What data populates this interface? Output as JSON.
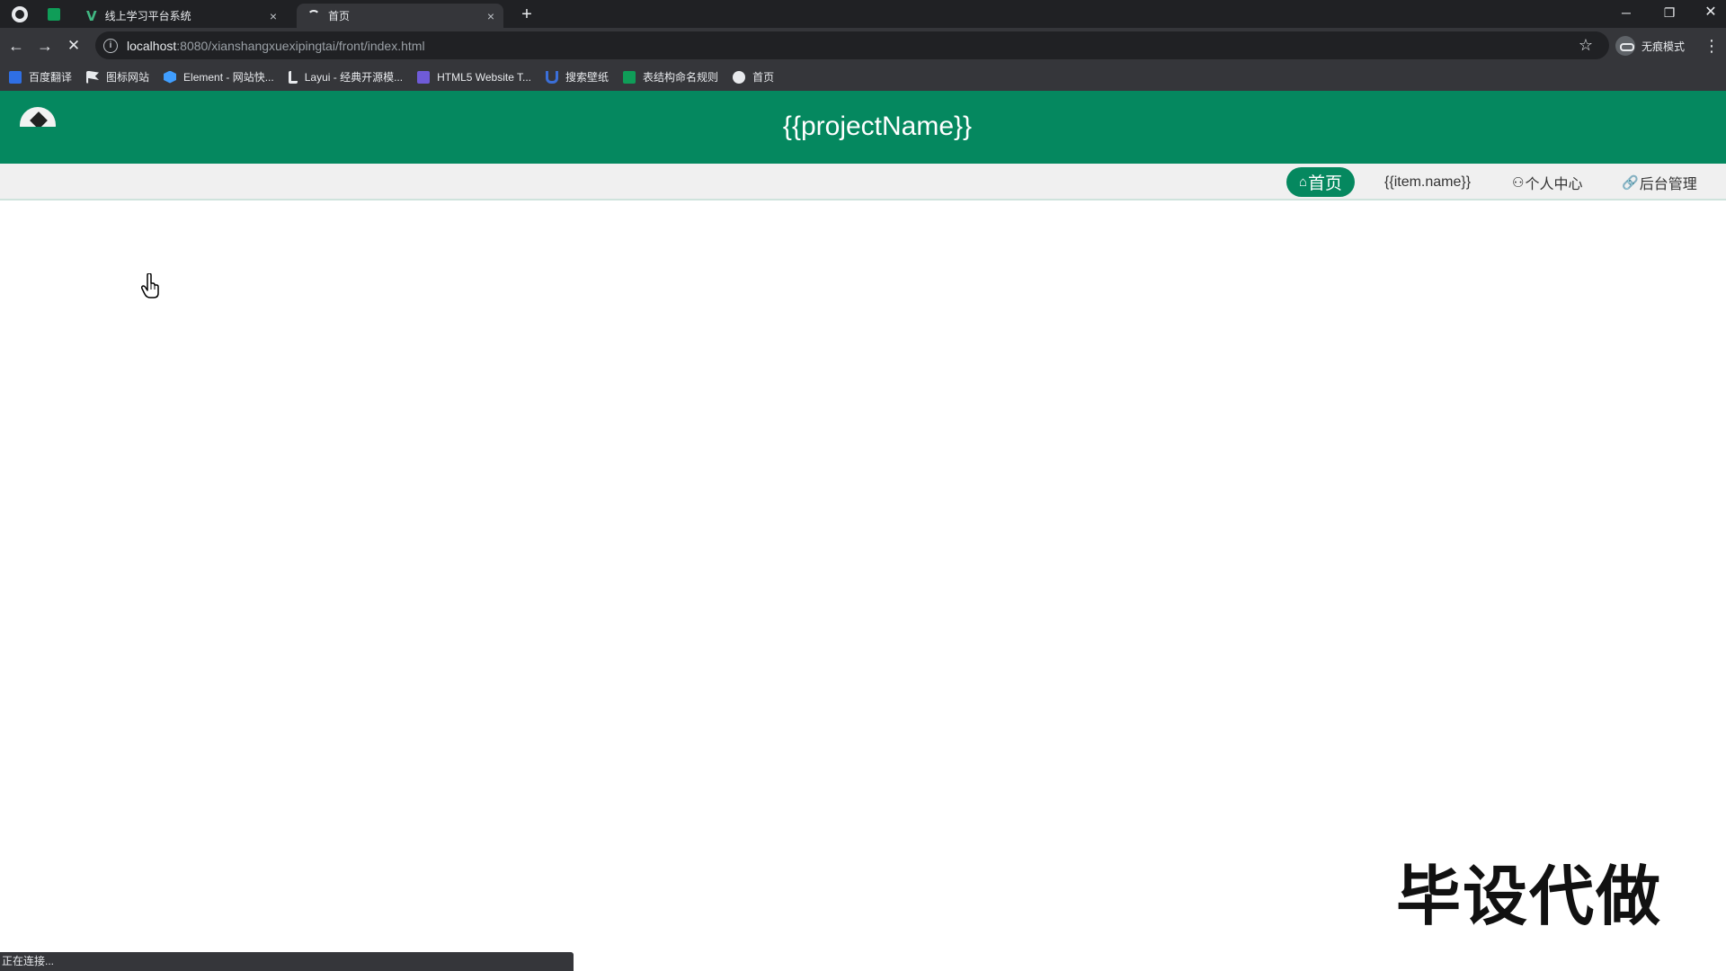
{
  "browser": {
    "tabs": [
      {
        "title": "线上学习平台系统",
        "close": "×"
      },
      {
        "title": "首页",
        "close": "×"
      }
    ],
    "new_tab": "+",
    "window_controls": {
      "minimize": "─",
      "restore": "❐",
      "close": "✕"
    },
    "nav": {
      "back": "←",
      "forward": "→",
      "stop": "✕"
    },
    "url": {
      "host": "localhost",
      "path": ":8080/xianshangxuexipingtai/front/index.html"
    },
    "bookmark_star": "☆",
    "profile_label": "无痕模式",
    "menu": "⋮",
    "bookmarks": [
      {
        "label": "百度翻译",
        "icon": "translate-icon",
        "color": "#2f6fe4"
      },
      {
        "label": "图标网站",
        "icon": "flag-icon",
        "color": "#e8eaed"
      },
      {
        "label": "Element - 网站快...",
        "icon": "element-icon",
        "color": "#409eff"
      },
      {
        "label": "Layui - 经典开源模...",
        "icon": "layui-icon",
        "color": "#e8eaed"
      },
      {
        "label": "HTML5 Website T...",
        "icon": "html5-icon",
        "color": "#6f5bd8"
      },
      {
        "label": "搜索壁纸",
        "icon": "wallpaper-icon",
        "color": "#3b6fd8"
      },
      {
        "label": "表结构命名规则",
        "icon": "sheet-icon",
        "color": "#0f9d58"
      },
      {
        "label": "首页",
        "icon": "globe-icon",
        "color": "#e8eaed"
      }
    ],
    "status": "正在连接..."
  },
  "page": {
    "title": "{{projectName}}",
    "nav": {
      "home": {
        "icon": "⌂",
        "label": "首页"
      },
      "dynamic": {
        "label": "{{item.name}}"
      },
      "user_center": {
        "icon": "⚇",
        "label": "个人中心"
      },
      "admin": {
        "icon": "🔗",
        "label": "后台管理"
      }
    }
  },
  "overlay": {
    "watermark": "毕设代做"
  },
  "colors": {
    "brand": "#05885f",
    "chrome_dark": "#202124",
    "chrome": "#35363a"
  }
}
